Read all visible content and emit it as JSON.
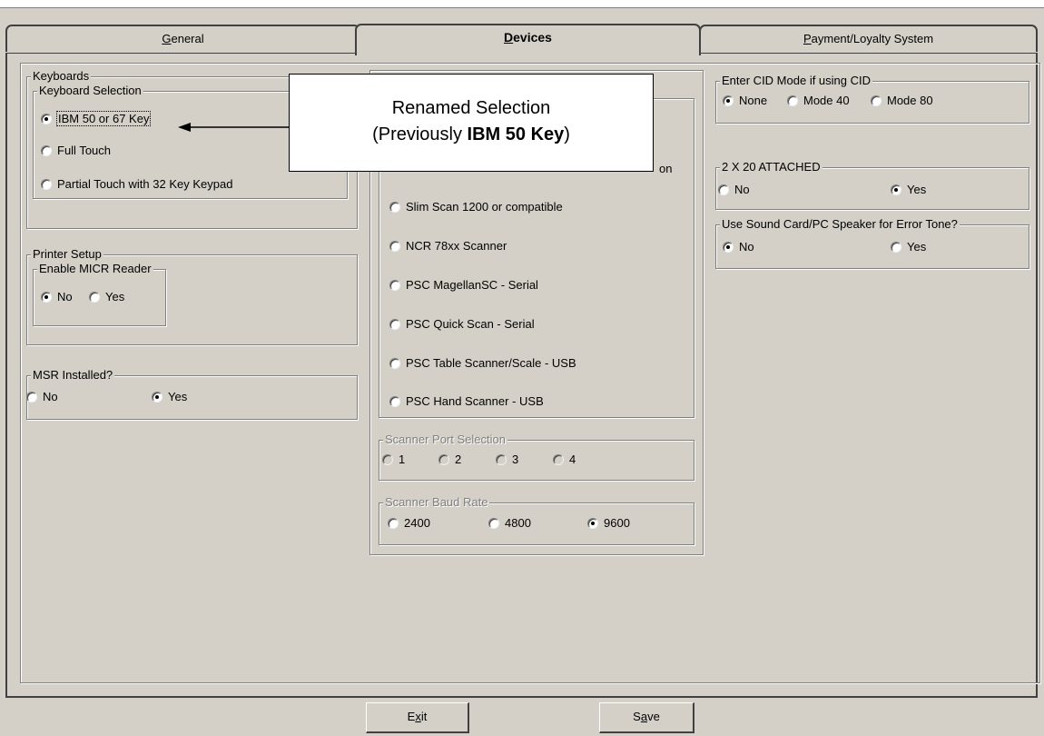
{
  "tabs": {
    "general": "General",
    "devices": "Devices",
    "payment": "Payment/Loyalty System"
  },
  "keyboards": {
    "title": "Keyboards",
    "selection_title": "Keyboard Selection",
    "options": [
      "IBM 50 or 67 Key",
      "Full Touch",
      "Partial Touch with 32 Key Keypad"
    ],
    "selected": "IBM 50 or 67 Key"
  },
  "printer": {
    "title": "Printer Setup",
    "micr_title": "Enable MICR Reader",
    "options": [
      "No",
      "Yes"
    ],
    "selected": "No"
  },
  "msr": {
    "title": "MSR Installed?",
    "options": [
      "No",
      "Yes"
    ],
    "selected": "Yes"
  },
  "scanner": {
    "partial_option": "on",
    "options": [
      "Slim Scan 1200 or compatible",
      "NCR 78xx Scanner",
      "PSC MagellanSC - Serial",
      "PSC Quick Scan - Serial",
      "PSC Table Scanner/Scale - USB",
      "PSC Hand Scanner - USB"
    ],
    "port_title": "Scanner Port Selection",
    "port_options": [
      "1",
      "2",
      "3",
      "4"
    ],
    "baud_title": "Scanner Baud Rate",
    "baud_options": [
      "2400",
      "4800",
      "9600"
    ],
    "baud_selected": "9600"
  },
  "cid": {
    "title": "Enter CID Mode if using CID",
    "options": [
      "None",
      "Mode 40",
      "Mode 80"
    ],
    "selected": "None"
  },
  "attached": {
    "title": "2 X 20 ATTACHED",
    "options": [
      "No",
      "Yes"
    ],
    "selected": "Yes"
  },
  "sound": {
    "title": "Use Sound Card/PC Speaker for Error Tone?",
    "options": [
      "No",
      "Yes"
    ],
    "selected": "No"
  },
  "callout": {
    "line1": "Renamed Selection",
    "line2_prefix": "(Previously ",
    "line2_bold": "IBM 50 Key",
    "line2_suffix": ")"
  },
  "buttons": {
    "exit": "Exit",
    "save": "Save"
  }
}
